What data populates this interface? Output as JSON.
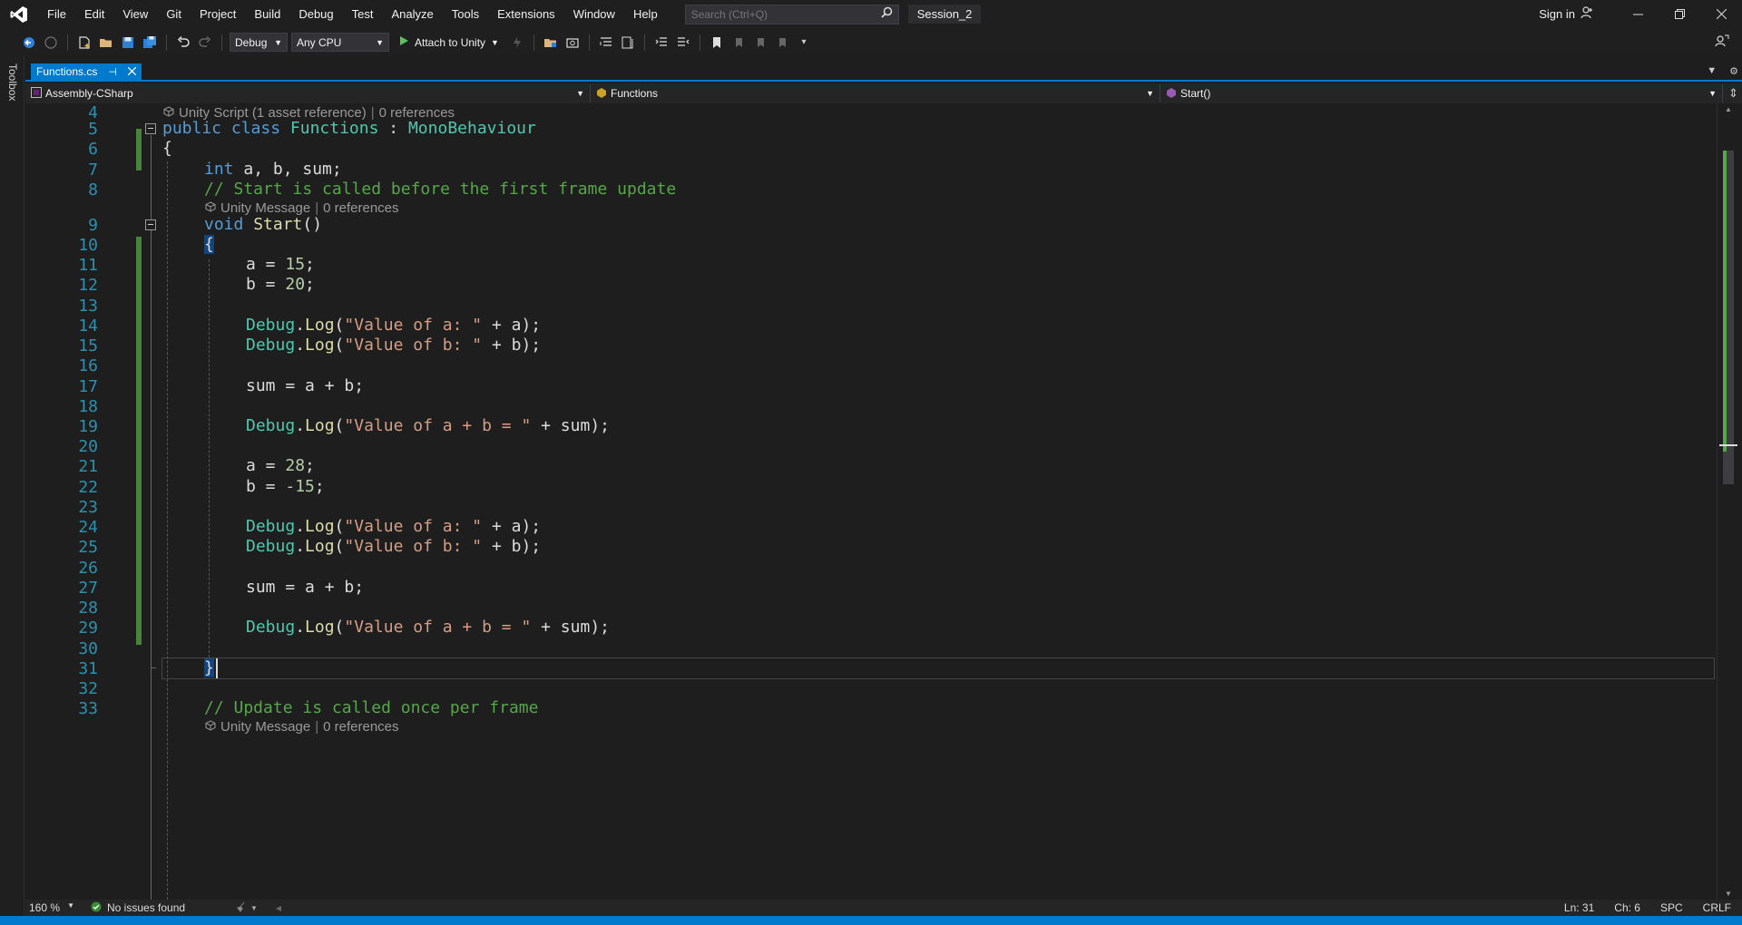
{
  "menu": {
    "items": [
      "File",
      "Edit",
      "View",
      "Git",
      "Project",
      "Build",
      "Debug",
      "Test",
      "Analyze",
      "Tools",
      "Extensions",
      "Window",
      "Help"
    ],
    "search_placeholder": "Search (Ctrl+Q)",
    "session_name": "Session_2",
    "signin_label": "Sign in"
  },
  "toolbar": {
    "configuration": "Debug",
    "platform": "Any CPU",
    "attach_label": "Attach to Unity"
  },
  "toolbox_label": "Toolbox",
  "tab": {
    "filename": "Functions.cs",
    "pin_glyph": "⊣"
  },
  "nav": {
    "project": "Assembly-CSharp",
    "class": "Functions",
    "member": "Start()"
  },
  "editor": {
    "line_numbers": [
      "4",
      "5",
      "6",
      "7",
      "8",
      "9",
      "10",
      "11",
      "12",
      "13",
      "14",
      "15",
      "16",
      "17",
      "18",
      "19",
      "20",
      "21",
      "22",
      "23",
      "24",
      "25",
      "26",
      "27",
      "28",
      "29",
      "30",
      "31",
      "32",
      "33"
    ],
    "lens_class": {
      "label": "Unity Script (1 asset reference)",
      "refs": "0 references"
    },
    "lens_start": {
      "label": "Unity Message",
      "refs": "0 references"
    },
    "lens_update": {
      "label": "Unity Message",
      "refs": "0 references"
    },
    "tokens": {
      "public": "public",
      "class": "class",
      "class_name": "Functions",
      "colon": " : ",
      "base": "MonoBehaviour",
      "open_brace": "{",
      "close_brace": "}",
      "int": "int",
      "fields": " a, b, sum;",
      "comment_start": "// Start is called before the first frame update",
      "void": "void",
      "start_name": "Start",
      "parens": "()",
      "a_eq": "a = ",
      "b_eq": "b = ",
      "semi": ";",
      "v15": "15",
      "v20": "20",
      "v28": "28",
      "v_neg15": "-15",
      "debug": "Debug",
      "dot": ".",
      "log": "Log",
      "lparen": "(",
      "str_a": "\"Value of a: \"",
      "str_b": "\"Value of b: \"",
      "str_sum": "\"Value of a + b = \"",
      "plus_a": " + a);",
      "plus_b": " + b);",
      "plus_sum": " + sum);",
      "sum_assign": "sum = a + b;",
      "comment_update": "// Update is called once per frame"
    }
  },
  "status": {
    "zoom": "160 %",
    "issues": "No issues found",
    "line": "Ln: 31",
    "col": "Ch: 6",
    "indent": "SPC",
    "eol": "CRLF"
  },
  "colors": {
    "accent": "#007acc",
    "keyword": "#569cd6",
    "type": "#4ec9b0",
    "comment": "#57a64a",
    "string": "#d69d85",
    "number": "#b5cea8",
    "method": "#dcdcaa",
    "line_number": "#2b91af"
  }
}
